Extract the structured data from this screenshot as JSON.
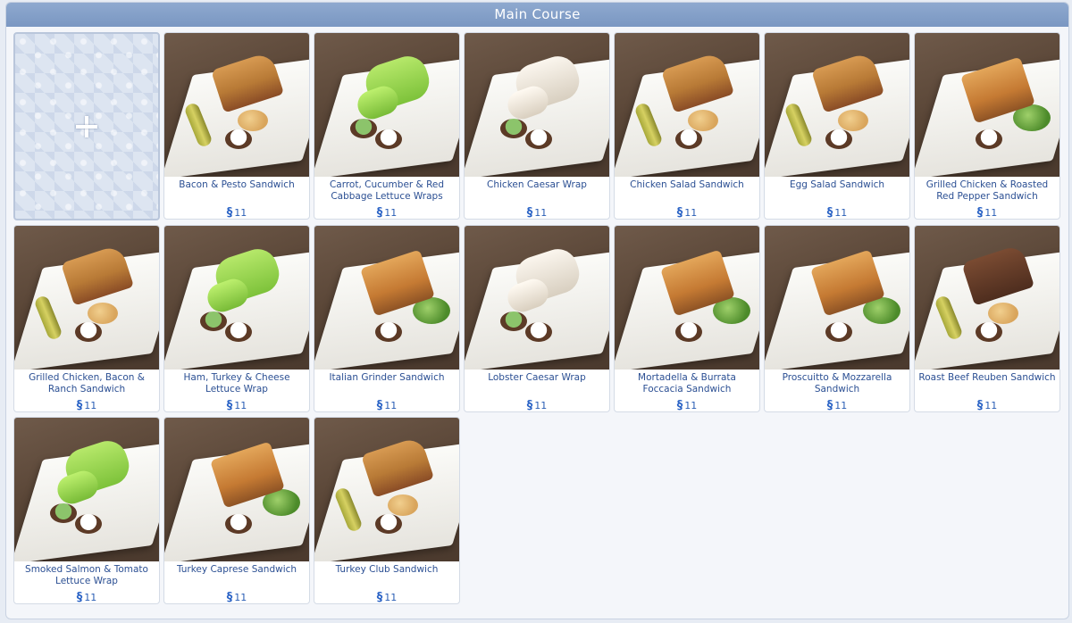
{
  "window": {
    "title": "Main Course"
  },
  "currency_symbol": "§",
  "items": [
    {
      "name": "Bacon & Pesto Sandwich",
      "price": "11",
      "style": "bread"
    },
    {
      "name": "Carrot, Cucumber & Red Cabbage Lettuce Wraps",
      "price": "11",
      "style": "wrap-green"
    },
    {
      "name": "Chicken Caesar Wrap",
      "price": "11",
      "style": "wrap-white"
    },
    {
      "name": "Chicken Salad Sandwich",
      "price": "11",
      "style": "bread"
    },
    {
      "name": "Egg Salad Sandwich",
      "price": "11",
      "style": "bread"
    },
    {
      "name": "Grilled Chicken & Roasted Red Pepper Sandwich",
      "price": "11",
      "style": "bake"
    },
    {
      "name": "Grilled Chicken, Bacon & Ranch Sandwich",
      "price": "11",
      "style": "bread"
    },
    {
      "name": "Ham, Turkey & Cheese Lettuce Wrap",
      "price": "11",
      "style": "wrap-green"
    },
    {
      "name": "Italian Grinder Sandwich",
      "price": "11",
      "style": "bake"
    },
    {
      "name": "Lobster Caesar Wrap",
      "price": "11",
      "style": "wrap-white"
    },
    {
      "name": "Mortadella & Burrata Foccacia Sandwich",
      "price": "11",
      "style": "bake"
    },
    {
      "name": "Proscuitto & Mozzarella Sandwich",
      "price": "11",
      "style": "bake"
    },
    {
      "name": "Roast Beef Reuben Sandwich",
      "price": "11",
      "style": "rye"
    },
    {
      "name": "Smoked Salmon & Tomato Lettuce Wrap",
      "price": "11",
      "style": "wrap-green"
    },
    {
      "name": "Turkey Caprese Sandwich",
      "price": "11",
      "style": "bake"
    },
    {
      "name": "Turkey Club Sandwich",
      "price": "11",
      "style": "bread"
    }
  ],
  "add_tile": {
    "icon": "plus-icon"
  }
}
